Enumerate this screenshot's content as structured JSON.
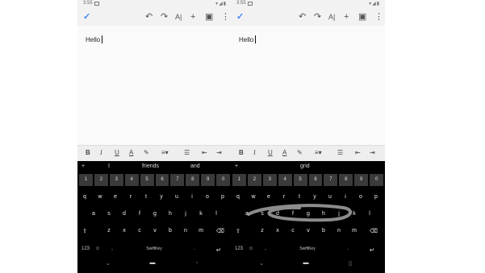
{
  "left": {
    "status": {
      "time": "3:55"
    },
    "doc": {
      "text": "Hello"
    },
    "suggestions": [
      "I",
      "friends",
      "and"
    ],
    "number_row": [
      "1",
      "2",
      "3",
      "4",
      "5",
      "6",
      "7",
      "8",
      "9",
      "0"
    ],
    "rows": [
      [
        "q",
        "w",
        "e",
        "r",
        "t",
        "y",
        "u",
        "i",
        "o",
        "p"
      ],
      [
        "a",
        "s",
        "d",
        "f",
        "g",
        "h",
        "j",
        "k",
        "l"
      ],
      [
        "z",
        "x",
        "c",
        "v",
        "b",
        "n",
        "m"
      ]
    ],
    "bottom": {
      "sym": "123",
      "emoji": "☺",
      "comma": ",",
      "brand": "SwiftKey",
      "period": ".",
      "enter": "↵"
    },
    "nav": {
      "back": "⌄",
      "recents": "◦"
    }
  },
  "right": {
    "status": {
      "time": "3:55"
    },
    "doc": {
      "text": "Hello"
    },
    "suggestions": [
      "grid"
    ],
    "number_row": [
      "1",
      "2",
      "3",
      "4",
      "5",
      "6",
      "7",
      "8",
      "9",
      "0"
    ],
    "rows": [
      [
        "q",
        "w",
        "e",
        "r",
        "t",
        "y",
        "u",
        "i",
        "o",
        "p"
      ],
      [
        "a",
        "s",
        "d",
        "f",
        "g",
        "h",
        "j",
        "k",
        "l"
      ],
      [
        "z",
        "x",
        "c",
        "v",
        "b",
        "n",
        "m"
      ]
    ],
    "bottom": {
      "sym": "123",
      "emoji": "☺",
      "comma": ",",
      "brand": "SwiftKey",
      "period": ".",
      "enter": "↵"
    },
    "nav": {
      "back": "⌄",
      "recents": "▯"
    }
  },
  "toolbar": {
    "check_icon": "✓",
    "undo_icon": "↶",
    "redo_icon": "↷",
    "text_format_label": "A|",
    "insert_icon": "+",
    "comment_icon": "▣",
    "more_icon": "⋮"
  },
  "format_bar": {
    "bold": "B",
    "italic": "I",
    "underline": "U",
    "text_color": "A",
    "highlight_icon": "✎",
    "align_icon": "≡▾",
    "list_icon": "☰",
    "outdent_icon": "⇤",
    "indent_icon": "⇥"
  },
  "keyboard": {
    "plus": "+",
    "shift_icon": "⇧",
    "backspace_icon": "⌫",
    "home_pill": "▬"
  },
  "colors": {
    "accent": "#4285f4",
    "keyboard_bg": "#000000",
    "number_key_bg": "#3a3a3a"
  }
}
